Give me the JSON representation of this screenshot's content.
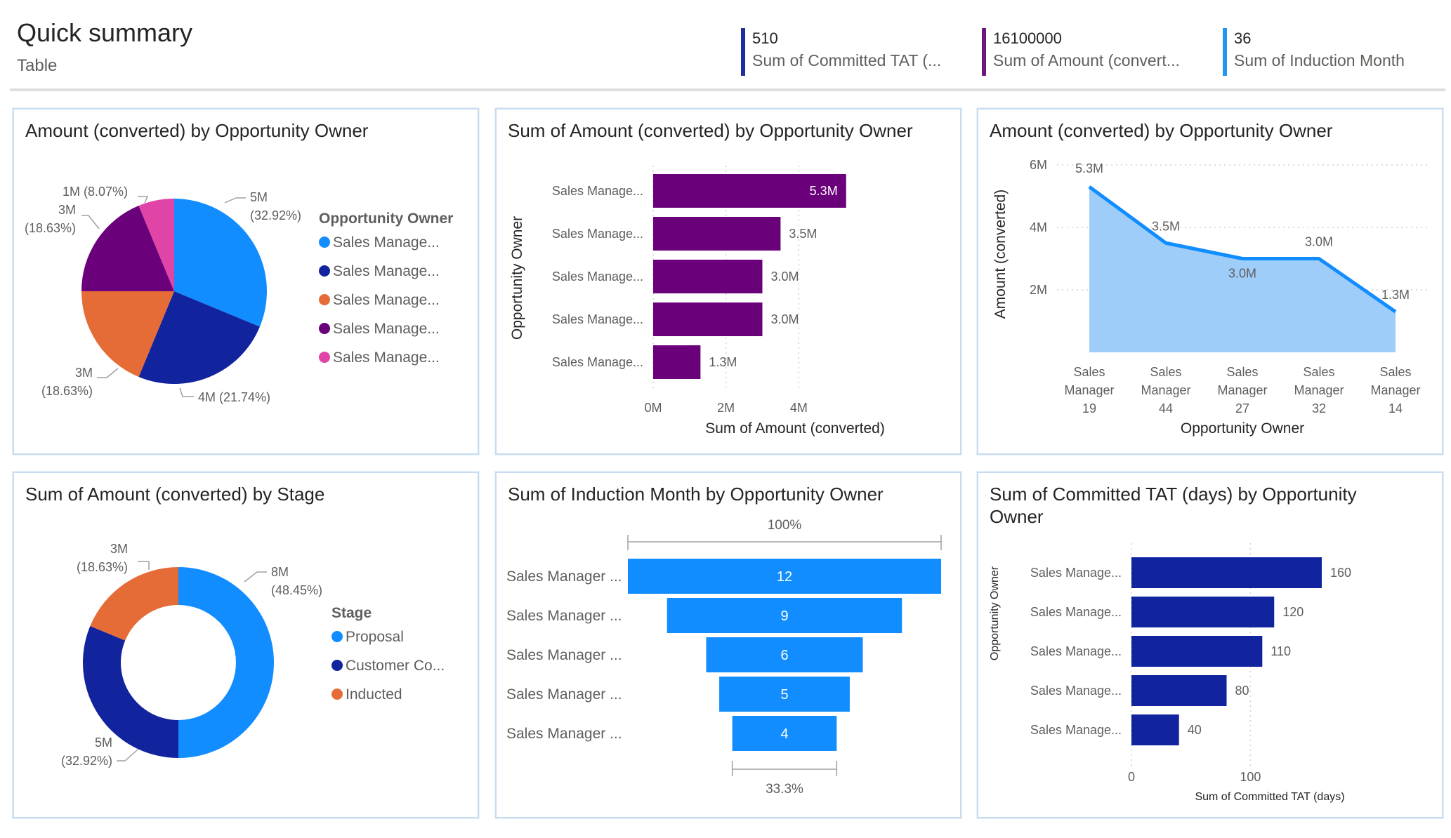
{
  "header": {
    "title": "Quick summary",
    "subtitle": "Table"
  },
  "kpis": [
    {
      "value": "510",
      "label": "Sum of Committed TAT (...",
      "color": "#1f2e9e"
    },
    {
      "value": "16100000",
      "label": "Sum of Amount (convert...",
      "color": "#6b1a7a"
    },
    {
      "value": "36",
      "label": "Sum of Induction Month",
      "color": "#2196f3"
    }
  ],
  "colors": {
    "blue": "#118dff",
    "navy": "#12239e",
    "orange": "#e66c37",
    "purple": "#6b007b",
    "pink": "#e044a7",
    "area": "#9fcdfa",
    "funnel": "#118dff"
  },
  "chart_data": [
    {
      "type": "pie",
      "title": "Amount (converted) by Opportunity Owner",
      "legend_title": "Opportunity Owner",
      "legend_position": "right",
      "slices": [
        {
          "label": "Sales Manage...",
          "value": 5,
          "percent": "32.92%",
          "display": "5M",
          "color": "#118dff"
        },
        {
          "label": "Sales Manage...",
          "value": 4,
          "percent": "21.74%",
          "display": "4M",
          "color": "#12239e"
        },
        {
          "label": "Sales Manage...",
          "value": 3,
          "percent": "18.63%",
          "display": "3M",
          "color": "#e66c37"
        },
        {
          "label": "Sales Manage...",
          "value": 3,
          "percent": "18.63%",
          "display": "3M",
          "color": "#6b007b"
        },
        {
          "label": "Sales Manage...",
          "value": 1,
          "percent": "8.07%",
          "display": "1M",
          "color": "#e044a7"
        }
      ]
    },
    {
      "type": "bar",
      "orientation": "horizontal",
      "title": "Sum of Amount (converted) by Opportunity Owner",
      "xlabel": "Sum of Amount (converted)",
      "ylabel": "Opportunity Owner",
      "categories": [
        "Sales Manage...",
        "Sales Manage...",
        "Sales Manage...",
        "Sales Manage...",
        "Sales Manage..."
      ],
      "values": [
        5.3,
        3.5,
        3.0,
        3.0,
        1.3
      ],
      "data_labels": [
        "5.3M",
        "3.5M",
        "3.0M",
        "3.0M",
        "1.3M"
      ],
      "xticks": [
        "0M",
        "2M",
        "4M"
      ],
      "xlim": [
        0,
        6
      ],
      "color": "#6b007b"
    },
    {
      "type": "area",
      "title": "Amount (converted) by Opportunity Owner",
      "xlabel": "Opportunity Owner",
      "ylabel": "Amount (converted)",
      "categories": [
        "Sales Manager 19",
        "Sales Manager 44",
        "Sales Manager 27",
        "Sales Manager 32",
        "Sales Manager 14"
      ],
      "category_lines": [
        [
          "Sales",
          "Manager",
          "19"
        ],
        [
          "Sales",
          "Manager",
          "44"
        ],
        [
          "Sales",
          "Manager",
          "27"
        ],
        [
          "Sales",
          "Manager",
          "32"
        ],
        [
          "Sales",
          "Manager",
          "14"
        ]
      ],
      "values": [
        5.3,
        3.5,
        3.0,
        3.0,
        1.3
      ],
      "data_labels": [
        "5.3M",
        "3.5M",
        "3.0M",
        "3.0M",
        "1.3M"
      ],
      "yticks": [
        "2M",
        "4M",
        "6M"
      ],
      "ylim": [
        0,
        6
      ],
      "grid": true
    },
    {
      "type": "pie",
      "variant": "donut",
      "title": "Sum of Amount (converted) by Stage",
      "legend_title": "Stage",
      "legend_position": "right",
      "slices": [
        {
          "label": "Proposal",
          "value": 8,
          "percent": "48.45%",
          "display": "8M",
          "color": "#118dff"
        },
        {
          "label": "Customer Co...",
          "value": 5,
          "percent": "32.92%",
          "display": "5M",
          "color": "#12239e"
        },
        {
          "label": "Inducted",
          "value": 3,
          "percent": "18.63%",
          "display": "3M",
          "color": "#e66c37"
        }
      ]
    },
    {
      "type": "bar",
      "variant": "funnel",
      "title": "Sum of Induction Month by Opportunity Owner",
      "categories": [
        "Sales Manager ...",
        "Sales Manager ...",
        "Sales Manager ...",
        "Sales Manager ...",
        "Sales Manager ..."
      ],
      "values": [
        12,
        9,
        6,
        5,
        4
      ],
      "top_label": "100%",
      "bottom_label": "33.3%",
      "color": "#118dff"
    },
    {
      "type": "bar",
      "orientation": "horizontal",
      "title": "Sum of Committed TAT (days) by Opportunity Owner",
      "title_lines": [
        "Sum of Committed TAT (days) by Opportunity",
        "Owner"
      ],
      "xlabel": "Sum of Committed TAT (days)",
      "ylabel": "Opportunity Owner",
      "categories": [
        "Sales Manage...",
        "Sales Manage...",
        "Sales Manage...",
        "Sales Manage...",
        "Sales Manage..."
      ],
      "values": [
        160,
        120,
        110,
        80,
        40
      ],
      "xticks": [
        "0",
        "100"
      ],
      "xlim": [
        0,
        160
      ],
      "color": "#12239e"
    }
  ]
}
